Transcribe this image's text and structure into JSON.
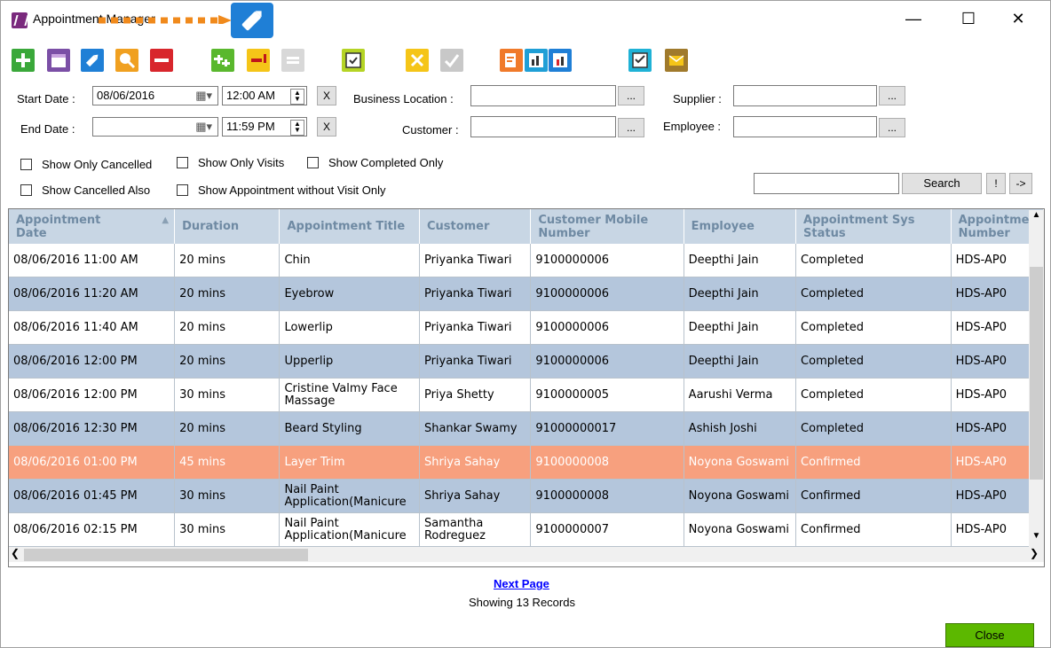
{
  "window": {
    "title": "Appointment Manager",
    "minimize": "—",
    "maximize": "☐",
    "close": "✕"
  },
  "toolbar": {
    "icons": [
      "add-icon",
      "calendar-icon",
      "edit-icon",
      "search-icon",
      "delete-icon",
      "add-item-icon",
      "remove-item-icon",
      "equals-icon",
      "calendar-check-icon",
      "cancel-icon",
      "confirm-icon",
      "notes-icon",
      "chart-icon",
      "staff-chart-icon",
      "checklist-icon",
      "email-icon"
    ],
    "colors": {
      "green": "#3aa83a",
      "purple": "#7b4fa6",
      "blue": "#1f7fd6",
      "orange": "#f0a020",
      "red": "#d8262c",
      "yellow": "#f5c518",
      "gray": "#c0c0c0",
      "brown": "#a07a2c"
    }
  },
  "filters": {
    "start_date_label": "Start Date :",
    "start_date": "08/06/2016",
    "start_time": "12:00 AM",
    "end_date_label": "End Date :",
    "end_date": "",
    "end_time": "11:59 PM",
    "clear": "X",
    "business_location_label": "Business Location :",
    "customer_label": "Customer :",
    "supplier_label": "Supplier :",
    "employee_label": "Employee :",
    "browse": "...",
    "checkboxes": {
      "show_only_cancelled": "Show Only Cancelled",
      "show_only_visits": "Show Only Visits",
      "show_completed_only": "Show Completed Only",
      "show_cancelled_also": "Show Cancelled Also",
      "show_appt_without_visit": "Show Appointment without Visit Only"
    },
    "search_value": "",
    "search_button": "Search",
    "bang_button": "!",
    "arrow_button": "->"
  },
  "grid": {
    "columns": [
      "Appointment Date",
      "Duration",
      "Appointment Title",
      "Customer",
      "Customer Mobile Number",
      "Employee",
      "Appointment Sys Status",
      "Appointment Number"
    ],
    "rows": [
      [
        "08/06/2016 11:00 AM",
        "20 mins",
        "Chin",
        "Priyanka Tiwari",
        "9100000006",
        "Deepthi Jain",
        "Completed",
        "HDS-AP0"
      ],
      [
        "08/06/2016 11:20 AM",
        "20 mins",
        "Eyebrow",
        "Priyanka Tiwari",
        "9100000006",
        "Deepthi Jain",
        "Completed",
        "HDS-AP0"
      ],
      [
        "08/06/2016 11:40 AM",
        "20 mins",
        "Lowerlip",
        "Priyanka Tiwari",
        "9100000006",
        "Deepthi Jain",
        "Completed",
        "HDS-AP0"
      ],
      [
        "08/06/2016 12:00 PM",
        "20 mins",
        "Upperlip",
        "Priyanka Tiwari",
        "9100000006",
        "Deepthi Jain",
        "Completed",
        "HDS-AP0"
      ],
      [
        "08/06/2016 12:00 PM",
        "30 mins",
        "Cristine Valmy Face Massage",
        "Priya Shetty",
        "9100000005",
        "Aarushi Verma",
        "Completed",
        "HDS-AP0"
      ],
      [
        "08/06/2016 12:30 PM",
        "20 mins",
        "Beard Styling",
        "Shankar Swamy",
        "91000000017",
        "Ashish Joshi",
        "Completed",
        "HDS-AP0"
      ],
      [
        "08/06/2016 01:00 PM",
        "45 mins",
        "Layer Trim",
        "Shriya Sahay",
        "9100000008",
        "Noyona Goswami",
        "Confirmed",
        "HDS-AP0"
      ],
      [
        "08/06/2016 01:45 PM",
        "30 mins",
        "Nail Paint Application(Manicure",
        "Shriya Sahay",
        "9100000008",
        "Noyona Goswami",
        "Confirmed",
        "HDS-AP0"
      ],
      [
        "08/06/2016 02:15 PM",
        "30 mins",
        "Nail Paint Application(Manicure",
        "Samantha Rodreguez",
        "9100000007",
        "Noyona Goswami",
        "Confirmed",
        "HDS-AP0"
      ]
    ],
    "selected_row": 6
  },
  "footer": {
    "next_page": "Next Page",
    "records": "Showing 13 Records",
    "close_button": "Close"
  }
}
